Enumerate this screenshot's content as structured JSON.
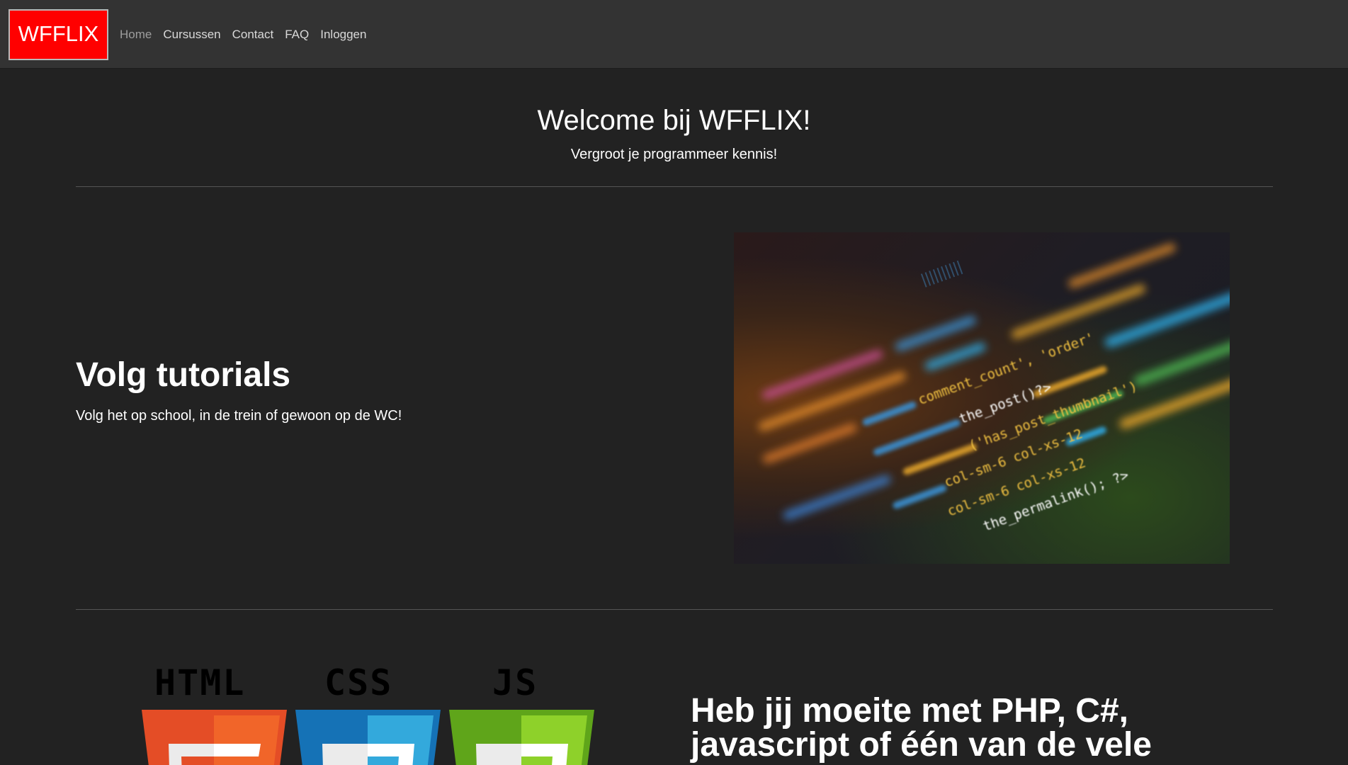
{
  "navbar": {
    "brand": "WFFLIX",
    "links": [
      {
        "label": "Home",
        "active": true
      },
      {
        "label": "Cursussen",
        "active": false
      },
      {
        "label": "Contact",
        "active": false
      },
      {
        "label": "FAQ",
        "active": false
      },
      {
        "label": "Inloggen",
        "active": false
      }
    ]
  },
  "hero": {
    "title": "Welcome bij WFFLIX!",
    "subtitle": "Vergroot je programmeer kennis!"
  },
  "feature1": {
    "title": "Volg tutorials",
    "text": "Volg het op school, in de trein of gewoon op de WC!",
    "image_icon": "code-screen-image"
  },
  "feature2": {
    "logos": [
      {
        "label": "HTML",
        "color": "#e44d26",
        "color_light": "#f16529"
      },
      {
        "label": "CSS",
        "color": "#1572b6",
        "color_light": "#33a9dc"
      },
      {
        "label": "JS",
        "color": "#5fa51a",
        "color_light": "#8ed12a"
      }
    ],
    "title": "Heb jij moeite met PHP, C#, javascript of één van de vele"
  },
  "colors": {
    "background": "#222222",
    "navbar": "#333333",
    "brand": "#ff0000"
  }
}
